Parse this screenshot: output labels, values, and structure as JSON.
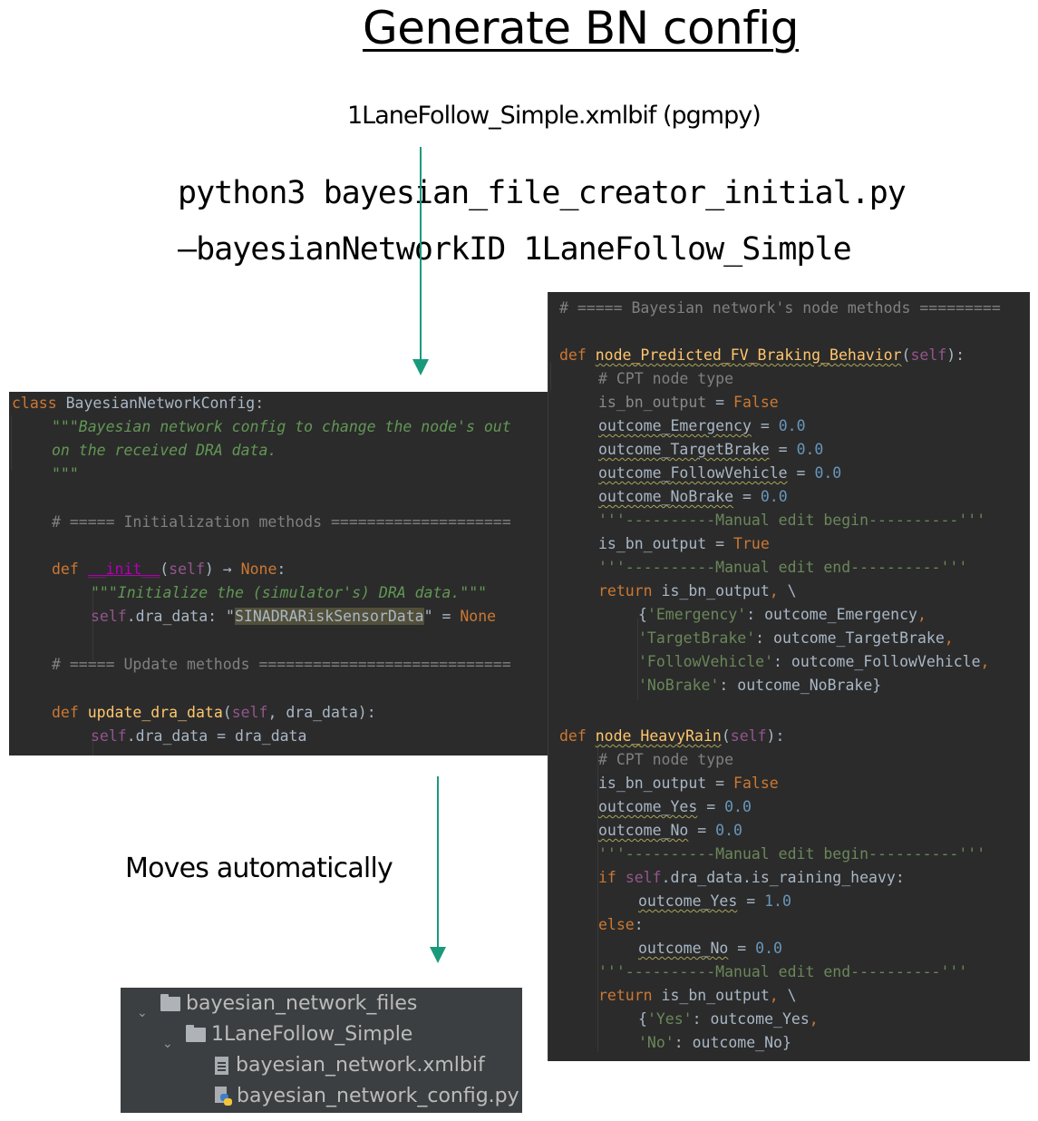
{
  "title": "Generate BN config",
  "subtitle": "1LaneFollow_Simple.xmlbif (pgmpy)",
  "command": {
    "line1": "python3 bayesian_file_creator_initial.py",
    "line2": "–bayesianNetworkID 1LaneFollow_Simple"
  },
  "moves_label": "Moves automatically",
  "colors": {
    "arrow": "#1a9a7c",
    "code_bg": "#2b2b2b",
    "tree_bg": "#3c3f41",
    "keyword": "#cc7832",
    "docstring": "#629755",
    "string": "#6a8759",
    "number": "#6897bb",
    "self": "#94558d",
    "function": "#ffc66d",
    "comment": "#808080"
  },
  "left_code": {
    "class_kw": "class",
    "class_name": "BayesianNetworkConfig:",
    "doc1": "\"\"\"Bayesian network config to change the node's out",
    "doc2": "on the received DRA data.",
    "doc3": "\"\"\"",
    "comment_init": "# ===== Initialization methods ====================",
    "def_kw": "def",
    "init_name": "__init__",
    "init_open": "(",
    "self": "self",
    "init_close": ") → ",
    "none": "None",
    "colon": ":",
    "init_doc": "\"\"\"Initialize the (simulator's) DRA data.\"\"\"",
    "dra_attr": ".dra_data: \"",
    "dra_type": "SINADRARiskSensorData",
    "dra_mid": "\" = ",
    "comment_update": "# ===== Update methods ============================",
    "update_name": "update_dra_data",
    "update_args": ", dra_data):",
    "update_body": ".dra_data = dra_data"
  },
  "right_code": {
    "comment_header": "# ===== Bayesian network's node methods =========",
    "def_kw": "def",
    "self": "self",
    "node1_name": "node_Predicted_FV_Braking_Behavior",
    "cpt_comment": "# CPT node type",
    "is_bn_output": "is_bn_output",
    "eq": " = ",
    "false": "False",
    "true": "True",
    "zero": "0.0",
    "one": "1.0",
    "outcome_emergency": "outcome_Emergency",
    "outcome_targetbrake": "outcome_TargetBrake",
    "outcome_followvehicle": "outcome_FollowVehicle",
    "outcome_nobrake": "outcome_NoBrake",
    "manual_begin": "'''----------Manual edit begin----------'''",
    "manual_end": "'''----------Manual edit end----------'''",
    "return_kw": "return",
    "return_rest": " is_bn_output",
    "return_tail": ", \\",
    "key_emergency": "'Emergency'",
    "key_targetbrake": "'TargetBrake'",
    "key_followvehicle": "'FollowVehicle'",
    "key_nobrake": "'NoBrake'",
    "node2_name": "node_HeavyRain",
    "outcome_yes": "outcome_Yes",
    "outcome_no": "outcome_No",
    "if_kw": "if",
    "if_cond": ".dra_data.is_raining_heavy:",
    "else_kw": "else",
    "key_yes": "'Yes'",
    "key_no": "'No'"
  },
  "file_tree": {
    "items": [
      {
        "label": "bayesian_network_files",
        "type": "folder",
        "expanded": true
      },
      {
        "label": "1LaneFollow_Simple",
        "type": "folder",
        "expanded": true
      },
      {
        "label": "bayesian_network.xmlbif",
        "type": "file"
      },
      {
        "label": "bayesian_network_config.py",
        "type": "python-file"
      }
    ]
  }
}
